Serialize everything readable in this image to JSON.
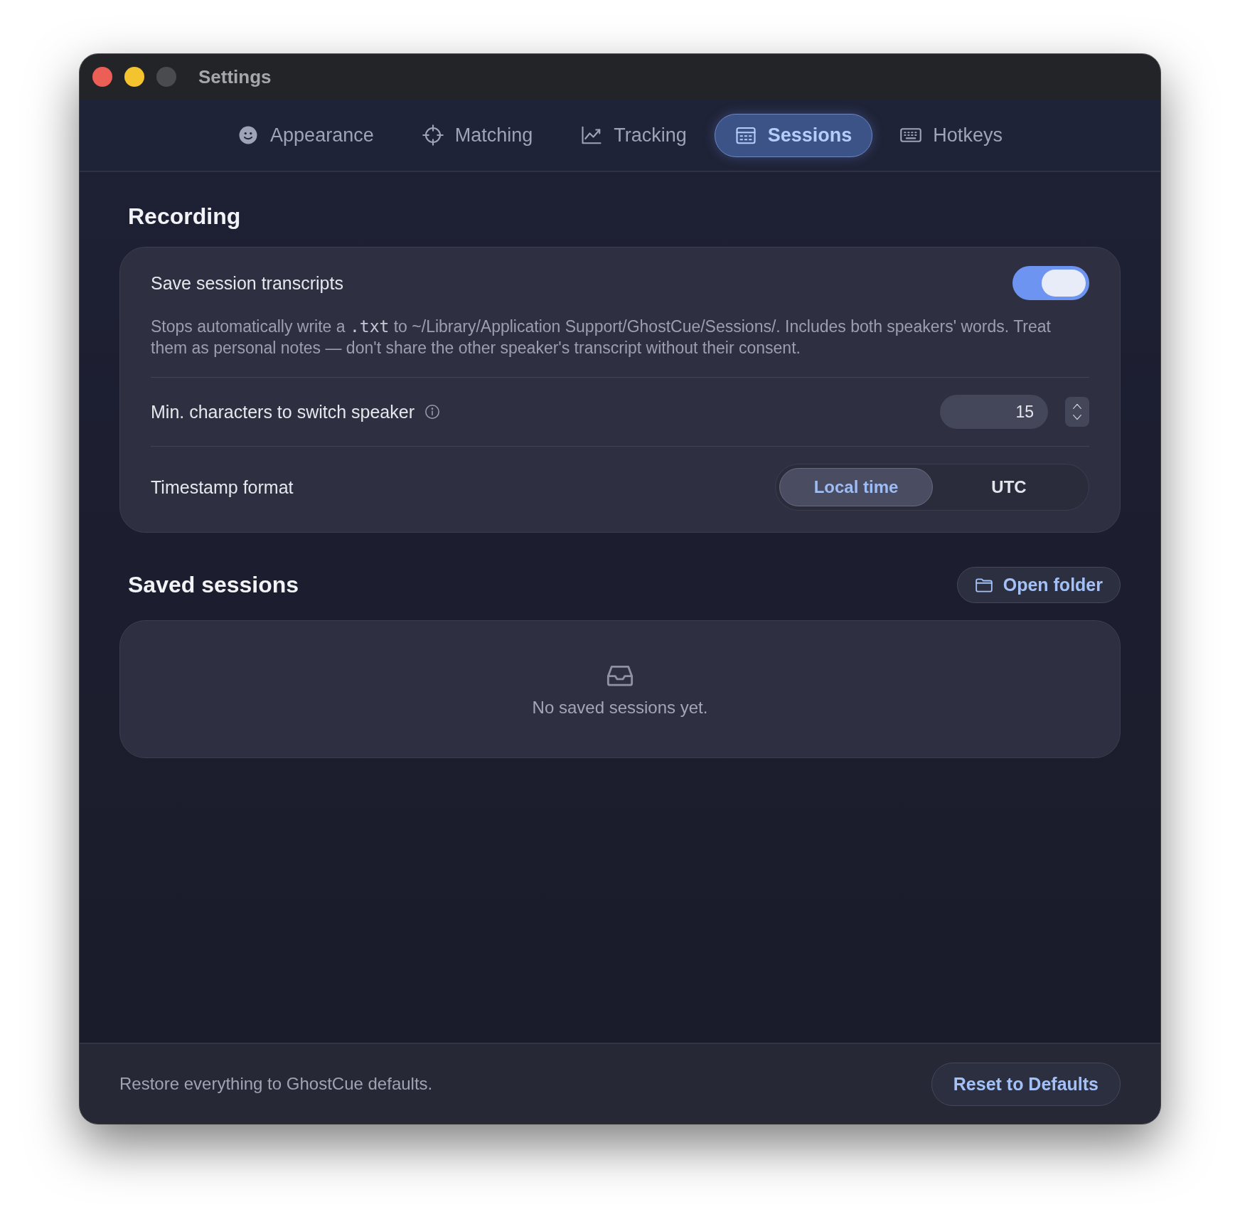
{
  "window": {
    "title": "Settings"
  },
  "tabs": [
    {
      "label": "Appearance",
      "kind": "appearance",
      "selected": false
    },
    {
      "label": "Matching",
      "kind": "matching",
      "selected": false
    },
    {
      "label": "Tracking",
      "kind": "tracking",
      "selected": false
    },
    {
      "label": "Sessions",
      "kind": "sessions",
      "selected": true
    },
    {
      "label": "Hotkeys",
      "kind": "hotkeys",
      "selected": false
    }
  ],
  "recording": {
    "heading": "Recording",
    "save_transcripts": {
      "label": "Save session transcripts",
      "on": true,
      "description": {
        "before": "Stops automatically write a ",
        "code": ".txt",
        "after": " to ~/Library/Application Support/GhostCue/Sessions/. Includes both speakers' words. Treat them as personal notes — don't share the other speaker's transcript without their consent."
      }
    },
    "min_chars": {
      "label": "Min. characters to switch speaker",
      "value": "15"
    },
    "timestamp_format": {
      "label": "Timestamp format",
      "options": [
        {
          "label": "Local time",
          "selected": true
        },
        {
          "label": "UTC",
          "selected": false
        }
      ]
    }
  },
  "saved_sessions": {
    "heading": "Saved sessions",
    "open_folder": "Open folder",
    "empty_text": "No saved sessions yet."
  },
  "footer": {
    "text": "Restore everything to GhostCue defaults.",
    "button": "Reset to Defaults"
  }
}
